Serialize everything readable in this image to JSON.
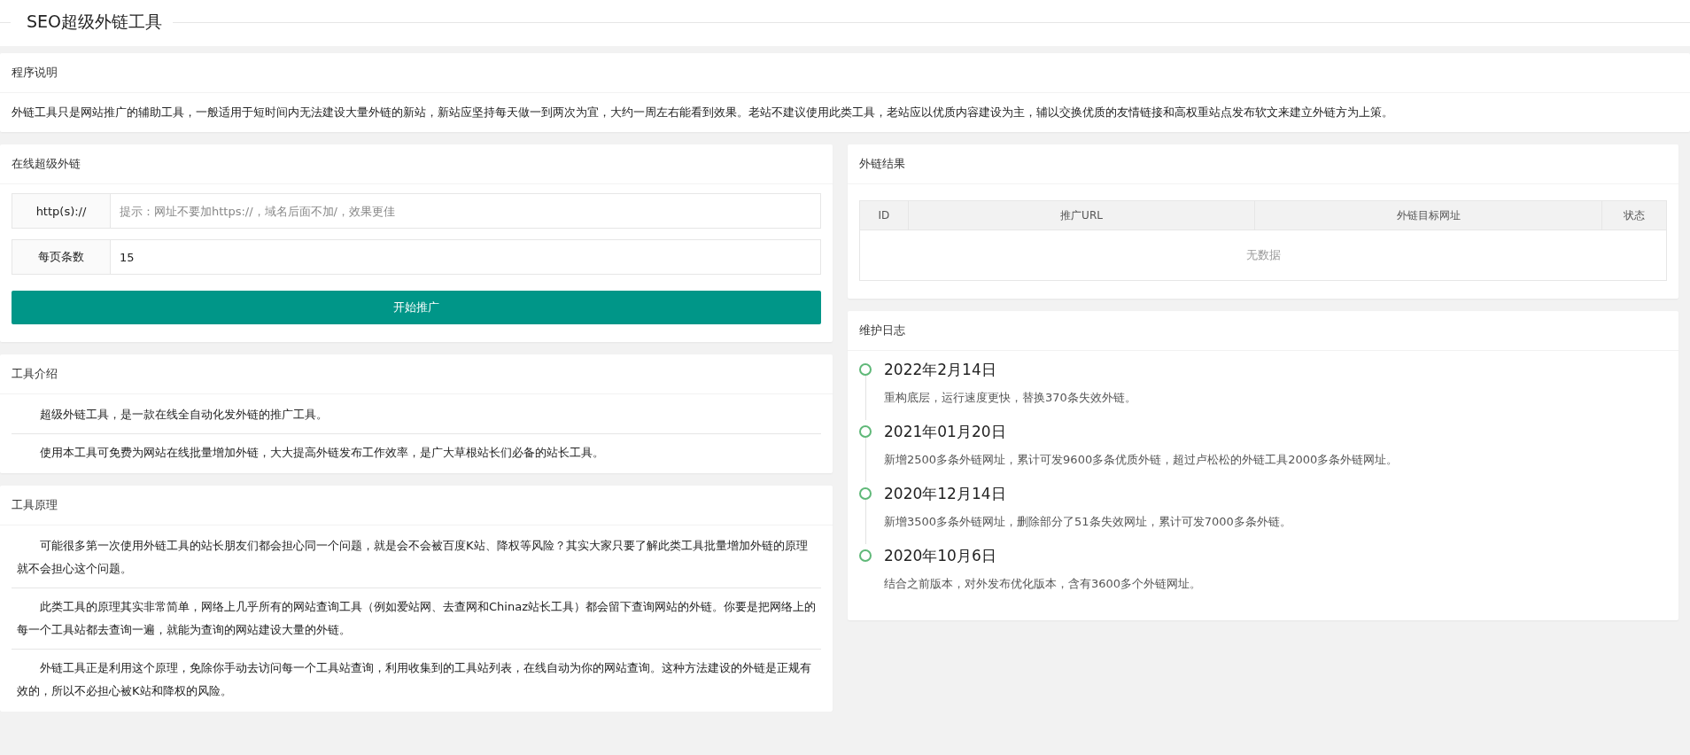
{
  "page_title": "SEO超级外链工具",
  "intro_card": {
    "title": "程序说明",
    "text": "外链工具只是网站推广的辅助工具，一般适用于短时间内无法建设大量外链的新站，新站应坚持每天做一到两次为宜，大约一周左右能看到效果。老站不建议使用此类工具，老站应以优质内容建设为主，辅以交换优质的友情链接和高权重站点发布软文来建立外链方为上策。"
  },
  "form_card": {
    "title": "在线超级外链",
    "fields": [
      {
        "label": "http(s)://",
        "placeholder": "提示：网址不要加https://，域名后面不加/，效果更佳"
      },
      {
        "label": "每页条数",
        "value": "15"
      }
    ],
    "button": "开始推广"
  },
  "result_card": {
    "title": "外链结果",
    "table": {
      "columns": [
        "ID",
        "推广URL",
        "外链目标网址",
        "状态"
      ],
      "empty_text": "无数据"
    }
  },
  "about_card": {
    "title": "工具介绍",
    "paragraphs": [
      "超级外链工具，是一款在线全自动化发外链的推广工具。",
      "使用本工具可免费为网站在线批量增加外链，大大提高外链发布工作效率，是广大草根站长们必备的站长工具。"
    ]
  },
  "principle_card": {
    "title": "工具原理",
    "paragraphs": [
      "可能很多第一次使用外链工具的站长朋友们都会担心同一个问题，就是会不会被百度K站、降权等风险？其实大家只要了解此类工具批量增加外链的原理就不会担心这个问题。",
      "此类工具的原理其实非常简单，网络上几乎所有的网站查询工具（例如爱站网、去查网和Chinaz站长工具）都会留下查询网站的外链。你要是把网络上的每一个工具站都去查询一遍，就能为查询的网站建设大量的外链。",
      "外链工具正是利用这个原理，免除你手动去访问每一个工具站查询，利用收集到的工具站列表，在线自动为你的网站查询。这种方法建设的外链是正规有效的，所以不必担心被K站和降权的风险。"
    ]
  },
  "log_card": {
    "title": "维护日志",
    "entries": [
      {
        "date": "2022年2月14日",
        "text": "重构底层，运行速度更快，替换370条失效外链。"
      },
      {
        "date": "2021年01月20日",
        "text": "新增2500多条外链网址，累计可发9600多条优质外链，超过卢松松的外链工具2000多条外链网址。"
      },
      {
        "date": "2020年12月14日",
        "text": "新增3500多条外链网址，删除部分了51条失效网址，累计可发7000多条外链。"
      },
      {
        "date": "2020年10月6日",
        "text": "结合之前版本，对外发布优化版本，含有3600多个外链网址。"
      }
    ]
  }
}
